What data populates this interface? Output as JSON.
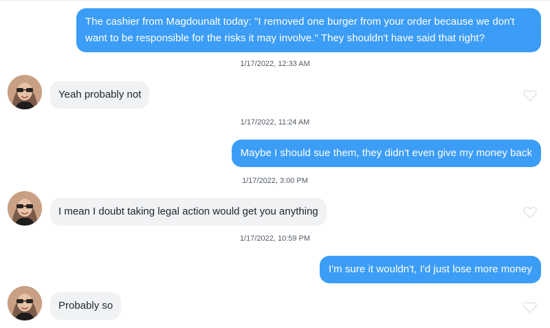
{
  "messages": [
    {
      "dir": "out",
      "text": "The cashier from Magdounalt today: \"I removed one burger from your order because we don't want to be responsible for the risks it may involve.\" They shouldn't have said that right?"
    },
    {
      "dir": "in",
      "text": "Yeah probably not"
    },
    {
      "dir": "out",
      "text": "Maybe I should sue them, they didn't even give my money back"
    },
    {
      "dir": "in",
      "text": "I mean I doubt taking legal action would get you anything"
    },
    {
      "dir": "out",
      "text": "I'm sure it wouldn't, I'd just lose more money"
    },
    {
      "dir": "in",
      "text": "Probably so"
    }
  ],
  "timestamps": [
    "1/17/2022, 12:33 AM",
    "1/17/2022, 11:24 AM",
    "1/17/2022, 3:00 PM",
    "1/17/2022, 10:59 PM"
  ],
  "colors": {
    "outgoing_bubble": "#3c9df6",
    "incoming_bubble": "#f0f2f4",
    "timestamp_text": "#505965",
    "heart_outline": "#dde1e6"
  },
  "icons": {
    "like": "heart-outline-icon",
    "avatar": "user-avatar"
  }
}
